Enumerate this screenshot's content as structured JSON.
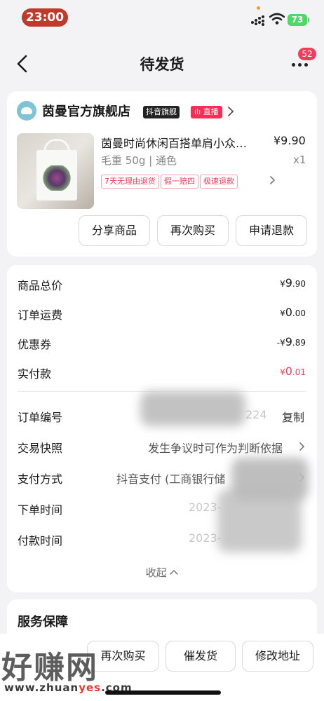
{
  "status": {
    "time": "23:00",
    "battery": "73"
  },
  "nav": {
    "title": "待发货",
    "badge": "52"
  },
  "shop": {
    "name": "茵曼官方旗舰店",
    "tag_flagship": "抖音旗舰",
    "tag_live": "直播"
  },
  "product": {
    "title": "茵曼时尚休闲百搭单肩小众…",
    "price": "¥9.90",
    "spec": "毛重 50g | 通色",
    "qty": "x1",
    "policies": [
      "7天无理由退货",
      "假一赔四",
      "极速退款"
    ]
  },
  "actions": {
    "share": "分享商品",
    "rebuy": "再次购买",
    "refund": "申请退款"
  },
  "price_rows": [
    {
      "label": "商品总价",
      "prefix": "¥",
      "main": "9",
      "decimal": ".90"
    },
    {
      "label": "订单运费",
      "prefix": "¥",
      "main": "0",
      "decimal": ".00"
    },
    {
      "label": "优惠券",
      "prefix": "-¥",
      "main": "9",
      "decimal": ".89"
    },
    {
      "label": "实付款",
      "prefix": "¥",
      "main": "0",
      "decimal": ".01",
      "color": "#f23c5b"
    }
  ],
  "info_rows": {
    "order_no": {
      "label": "订单编号",
      "value_tail": "224",
      "copy": "复制"
    },
    "snapshot": {
      "label": "交易快照",
      "value": "发生争议时可作为判断依据"
    },
    "payment": {
      "label": "支付方式",
      "value": "抖音支付 (工商银行储"
    },
    "order_time": {
      "label": "下单时间",
      "value": "2023-"
    },
    "pay_time": {
      "label": "付款时间",
      "value": "2023-"
    }
  },
  "collapse_label": "收起",
  "service": {
    "title": "服务保障"
  },
  "bottom": {
    "rebuy": "再次购买",
    "urge": "催发货",
    "address": "修改地址"
  },
  "watermark": {
    "big": "好赚网",
    "url_a": "www.zhuan",
    "url_b": "yes",
    "url_c": ".com"
  },
  "colors": {
    "accent": "#f23c5b",
    "time_pill": "#c0392b"
  },
  "icons": [
    "back-icon",
    "more-icon",
    "wifi-icon",
    "chevron-right-icon",
    "chevron-up-icon"
  ]
}
